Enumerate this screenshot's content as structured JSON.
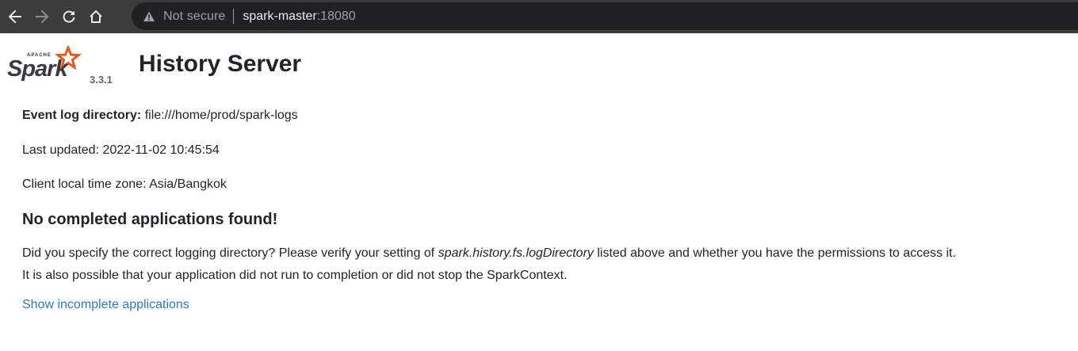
{
  "browser": {
    "security_label": "Not secure",
    "url_host": "spark-master",
    "url_port": ":18080",
    "icons": {
      "back": "arrow-left-icon",
      "forward": "arrow-right-icon",
      "reload": "reload-icon",
      "home": "home-icon",
      "security": "warning-triangle-icon"
    }
  },
  "header": {
    "logo_small_text": "APACHE",
    "logo_text": "Spark",
    "version": "3.3.1",
    "title": "History Server"
  },
  "info": {
    "event_log_label": "Event log directory:",
    "event_log_value": " file:///home/prod/spark-logs",
    "last_updated": "Last updated: 2022-11-02 10:45:54",
    "timezone": "Client local time zone: Asia/Bangkok"
  },
  "empty_state": {
    "heading": "No completed applications found!",
    "text_before": "Did you specify the correct logging directory? Please verify your setting of ",
    "setting_name": "spark.history.fs.logDirectory",
    "text_after": " listed above and whether you have the permissions to access it.",
    "text_line2": "It is also possible that your application did not run to completion or did not stop the SparkContext."
  },
  "actions": {
    "show_incomplete_label": "Show incomplete applications"
  },
  "colors": {
    "toolbar_bg": "#3c3c3c",
    "omnibox_bg": "#202124",
    "link": "#337ab7",
    "spark_orange": "#e25a1c"
  }
}
